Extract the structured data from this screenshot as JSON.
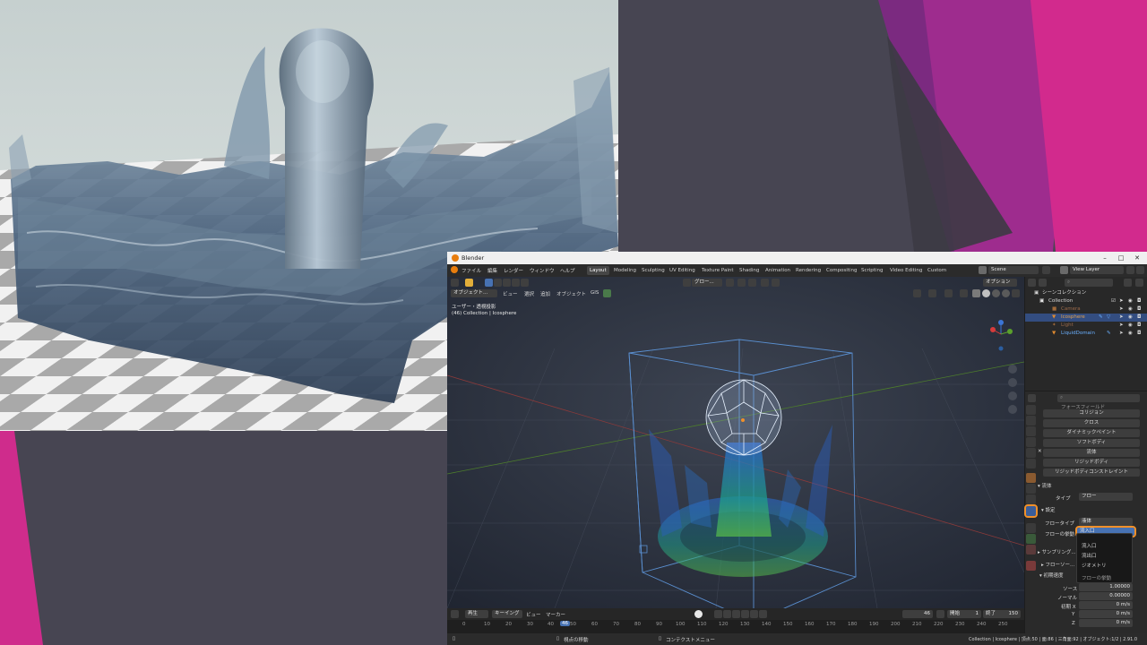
{
  "window": {
    "title": "Blender",
    "minimize": "–",
    "maximize": "□",
    "close": "✕"
  },
  "menu": {
    "items": [
      "ファイル",
      "編集",
      "レンダー",
      "ウィンドウ",
      "ヘルプ"
    ]
  },
  "workspaces": [
    "Layout",
    "Modeling",
    "Sculpting",
    "UV Editing",
    "Texture Paint",
    "Shading",
    "Animation",
    "Rendering",
    "Compositing",
    "Scripting",
    "Video Editing",
    "Custom"
  ],
  "scene": {
    "name": "Scene",
    "view_layer": "View Layer"
  },
  "tool_header": {
    "transform": "グロー...",
    "options": "オプション"
  },
  "viewport_header": {
    "mode": "オブジェクト...",
    "items": [
      "ビュー",
      "選択",
      "追加",
      "オブジェクト",
      "GIS"
    ]
  },
  "viewport": {
    "view_name": "ユーザー・透視投影",
    "collection_info": "(46) Collection | Icosphere"
  },
  "outliner": {
    "root": "シーンコレクション",
    "collection": "Collection",
    "items": [
      "Camera",
      "Icosphere",
      "Light",
      "LiquidDomain"
    ]
  },
  "properties": {
    "top_partial": "フォースフィールド",
    "physics_buttons": [
      "コリジョン",
      "クロス",
      "ダイナミックペイント",
      "ソフトボディ",
      "流体",
      "リジッドボディ",
      "リジッドボディコンストレイント"
    ],
    "fluid_panel": "流体",
    "type_label": "タイプ",
    "type_value": "フロー",
    "settings_label": "設定",
    "flow_type_label": "フロータイプ",
    "flow_type_value": "液体",
    "flow_behavior_label": "フローの挙動",
    "flow_behavior_value": "流入口",
    "sampling_label": "サンプリング...",
    "flow_source_label": "フローソー...",
    "initial_velocity_label": "初期速度",
    "source_label": "ソース",
    "source_value": "1.00000",
    "normal_label": "ノーマル",
    "normal_value": "0.00000",
    "initial_x_label": "初期 X",
    "initial_x_value": "0 m/s",
    "y_label": "Y",
    "y_value": "0 m/s",
    "z_label": "Z",
    "z_value": "0 m/s"
  },
  "dropdown": {
    "options": [
      "流入口",
      "流出口",
      "ジオメトリ"
    ],
    "footer": "フローの挙動"
  },
  "timeline": {
    "playback": "再生",
    "keying": "キーイング",
    "view": "ビュー",
    "marker": "マーカー",
    "current_frame": "46",
    "start_label": "開始",
    "start": "1",
    "end_label": "終了",
    "end": "150",
    "ruler": [
      "0",
      "10",
      "20",
      "30",
      "40",
      "46",
      "50",
      "60",
      "70",
      "80",
      "90",
      "100",
      "110",
      "120",
      "130",
      "140",
      "150",
      "160",
      "170",
      "180",
      "190",
      "200",
      "210",
      "220",
      "230",
      "240",
      "250"
    ]
  },
  "statusbar": {
    "left": "視点の移動",
    "middle": "コンテクストメニュー",
    "right": "Collection | Icosphere | 頂点:50 | 面:86 | 三角面:92 | オブジェクト:1/2 | 2.91.0"
  },
  "colors": {
    "accent_orange": "#f0902a",
    "selection_blue": "#4772b3",
    "slide_pink": "#d12b8a",
    "slide_purple": "#8f2b8c",
    "slide_bg": "#474552"
  }
}
